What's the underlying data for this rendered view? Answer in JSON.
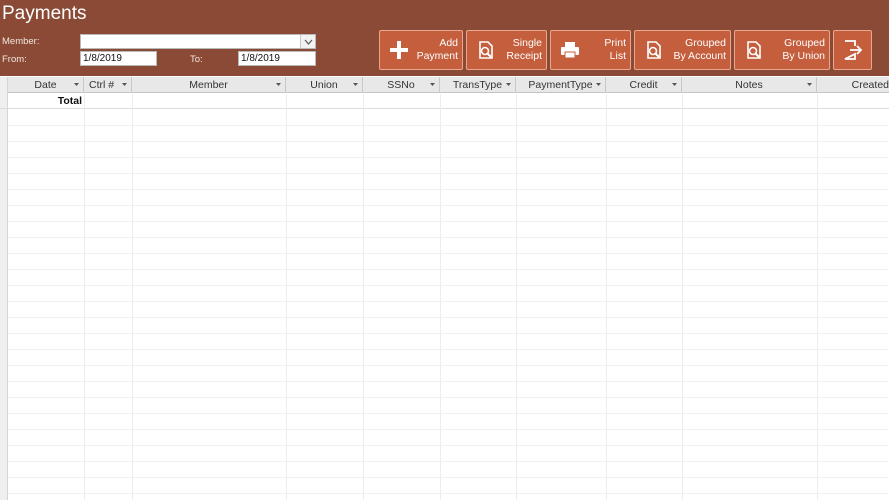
{
  "window": {
    "title": "Payments"
  },
  "filters": {
    "member_label": "Member:",
    "member_value": "",
    "from_label": "From:",
    "from_value": "1/8/2019",
    "to_label": "To:",
    "to_value": "1/8/2019"
  },
  "toolbar": {
    "add_payment": {
      "line1": "Add",
      "line2": "Payment",
      "icon": "plus-icon"
    },
    "single_receipt": {
      "line1": "Single",
      "line2": "Receipt",
      "icon": "magnifier-doc-icon"
    },
    "print_list": {
      "line1": "Print",
      "line2": "List",
      "icon": "printer-icon"
    },
    "grouped_by_account": {
      "line1": "Grouped",
      "line2": "By Account",
      "icon": "magnifier-doc-icon"
    },
    "grouped_by_union": {
      "line1": "Grouped",
      "line2": "By Union",
      "icon": "magnifier-doc-icon"
    },
    "exit": {
      "icon": "exit-door-icon"
    }
  },
  "grid": {
    "columns": [
      {
        "label": "Date",
        "dropdown": true
      },
      {
        "label": "Ctrl #",
        "dropdown": true
      },
      {
        "label": "Member",
        "dropdown": true
      },
      {
        "label": "Union",
        "dropdown": true
      },
      {
        "label": "SSNo",
        "dropdown": true
      },
      {
        "label": "TransType",
        "dropdown": true
      },
      {
        "label": "PaymentType",
        "dropdown": true
      },
      {
        "label": "Credit",
        "dropdown": true
      },
      {
        "label": "Notes",
        "dropdown": true
      },
      {
        "label": "Created",
        "dropdown": false
      }
    ],
    "total_label": "Total",
    "rows": []
  },
  "colors": {
    "header_bg": "#8a4a36",
    "button_bg": "#c45e3c",
    "button_border": "#e8a78f"
  }
}
